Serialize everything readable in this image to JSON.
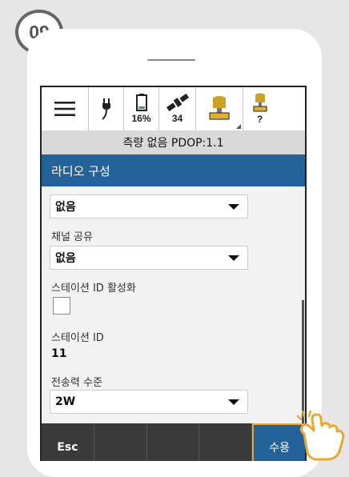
{
  "step_badge": "09",
  "status_bar": {
    "battery_percent": "16%",
    "satellites": "34",
    "receiver2_label": "?"
  },
  "info_strip": "측량 없음 PDOP:1.1",
  "title": "라디오 구성",
  "fields": {
    "field0_value": "없음",
    "channel_share_label": "채널 공유",
    "channel_share_value": "없음",
    "station_id_enable_label": "스테이션 ID 활성화",
    "station_id_label": "스테이션 ID",
    "station_id_value": "11",
    "tx_power_label": "전송력 수준",
    "tx_power_value": "2W"
  },
  "bottom_bar": {
    "esc_label": "Esc",
    "accept_label": "수용"
  },
  "colors": {
    "title_bar": "#24629a",
    "accept_border": "#e8a832",
    "bottom_bar": "#3a3a3a"
  }
}
